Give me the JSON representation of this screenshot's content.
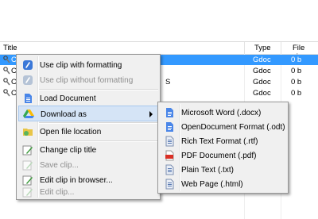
{
  "columns": {
    "title": "Title",
    "type": "Type",
    "size": "File size"
  },
  "rows": [
    {
      "title": "Cl",
      "title_tail": "",
      "type": "Gdoc",
      "size": "0 b",
      "selected": true
    },
    {
      "title": "Cl",
      "title_tail": "",
      "type": "Gdoc",
      "size": "0 b",
      "selected": false
    },
    {
      "title": "Cl",
      "title_tail": "S",
      "type": "Gdoc",
      "size": "0 b",
      "selected": false
    },
    {
      "title": "Cl",
      "title_tail": "",
      "type": "Gdoc",
      "size": "0 b",
      "selected": false
    }
  ],
  "context_menu": {
    "items": [
      {
        "label": "Use clip with formatting",
        "icon": "clip-icon",
        "disabled": false
      },
      {
        "label": "Use clip without formatting",
        "icon": "clip-icon",
        "disabled": true
      },
      {
        "label": "Load Document",
        "icon": "document-icon",
        "disabled": false
      },
      {
        "label": "Download as",
        "icon": "google-drive-icon",
        "disabled": false,
        "highlighted": true,
        "has_submenu": true
      },
      {
        "label": "Open file location",
        "icon": "folder-icon",
        "disabled": false
      },
      {
        "label": "Change clip title",
        "icon": "edit-icon",
        "disabled": false
      },
      {
        "label": "Save clip...",
        "icon": "save-icon",
        "disabled": true
      },
      {
        "label": "Edit clip in browser...",
        "icon": "browser-edit-icon",
        "disabled": false
      },
      {
        "label": "Edit clip...",
        "icon": "edit-icon",
        "disabled": true
      }
    ]
  },
  "submenu": {
    "items": [
      {
        "label": "Microsoft Word (.docx)",
        "icon": "word-doc-icon"
      },
      {
        "label": "OpenDocument Format (.odt)",
        "icon": "odt-doc-icon"
      },
      {
        "label": "Rich Text Format (.rtf)",
        "icon": "rtf-doc-icon"
      },
      {
        "label": "PDF Document (.pdf)",
        "icon": "pdf-doc-icon"
      },
      {
        "label": "Plain Text (.txt)",
        "icon": "text-doc-icon"
      },
      {
        "label": "Web Page (.html)",
        "icon": "html-doc-icon"
      }
    ]
  },
  "colors": {
    "selection": "#3399ff",
    "menu_bg": "#f0f0f0",
    "menu_highlight": "#d5e4f6"
  }
}
